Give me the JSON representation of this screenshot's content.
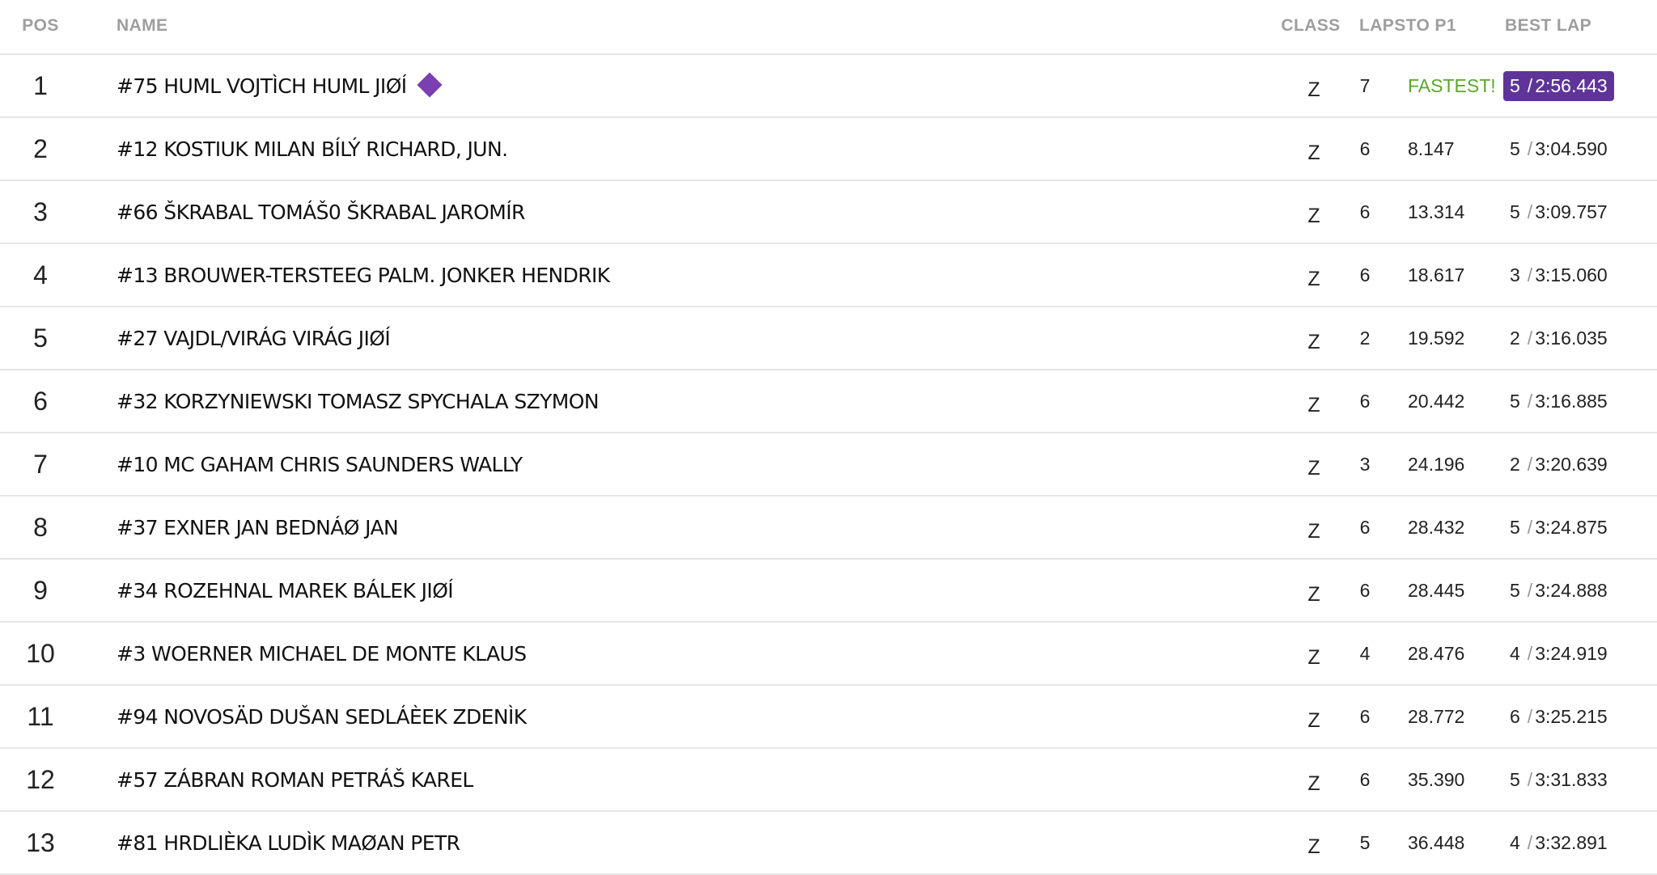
{
  "header": {
    "pos": "POS",
    "name": "NAME",
    "class": "CLASS",
    "laps_to_p1": "LAPSTO P1",
    "best_lap": "BEST LAP"
  },
  "rows": [
    {
      "pos": "1",
      "name": "#75 HUML VOJTÌCH HUML JIØÍ",
      "class": "Z",
      "laps": "7",
      "gap": "FASTEST!",
      "best_lap_no": "5",
      "best_time": "2:56.443",
      "best_icon": "diamond-icon"
    },
    {
      "pos": "2",
      "name": "#12 KOSTIUK MILAN BÍLÝ RICHARD, JUN.",
      "class": "Z",
      "laps": "6",
      "gap": "8.147",
      "best_lap_no": "5",
      "best_time": "3:04.590"
    },
    {
      "pos": "3",
      "name": "#66 ŠKRABAL TOMÁŠ0 ŠKRABAL JAROMÍR",
      "class": "Z",
      "laps": "6",
      "gap": "13.314",
      "best_lap_no": "5",
      "best_time": "3:09.757"
    },
    {
      "pos": "4",
      "name": "#13 BROUWER-TERSTEEG PALM. JONKER HENDRIK",
      "class": "Z",
      "laps": "6",
      "gap": "18.617",
      "best_lap_no": "3",
      "best_time": "3:15.060"
    },
    {
      "pos": "5",
      "name": "#27 VAJDL/VIRÁG VIRÁG JIØÍ",
      "class": "Z",
      "laps": "2",
      "gap": "19.592",
      "best_lap_no": "2",
      "best_time": "3:16.035"
    },
    {
      "pos": "6",
      "name": "#32 KORZYNIEWSKI TOMASZ SPYCHALA SZYMON",
      "class": "Z",
      "laps": "6",
      "gap": "20.442",
      "best_lap_no": "5",
      "best_time": "3:16.885"
    },
    {
      "pos": "7",
      "name": "#10 MC GAHAM CHRIS SAUNDERS WALLY",
      "class": "Z",
      "laps": "3",
      "gap": "24.196",
      "best_lap_no": "2",
      "best_time": "3:20.639"
    },
    {
      "pos": "8",
      "name": "#37 EXNER JAN BEDNÁØ JAN",
      "class": "Z",
      "laps": "6",
      "gap": "28.432",
      "best_lap_no": "5",
      "best_time": "3:24.875"
    },
    {
      "pos": "9",
      "name": "#34 ROZEHNAL MAREK BÁLEK JIØÍ",
      "class": "Z",
      "laps": "6",
      "gap": "28.445",
      "best_lap_no": "5",
      "best_time": "3:24.888"
    },
    {
      "pos": "10",
      "name": "#3 WOERNER MICHAEL DE MONTE KLAUS",
      "class": "Z",
      "laps": "4",
      "gap": "28.476",
      "best_lap_no": "4",
      "best_time": "3:24.919"
    },
    {
      "pos": "11",
      "name": "#94 NOVOSÄD DUŠAN SEDLÁÈEK ZDENÌK",
      "class": "Z",
      "laps": "6",
      "gap": "28.772",
      "best_lap_no": "6",
      "best_time": "3:25.215"
    },
    {
      "pos": "12",
      "name": "#57 ZÁBRAN ROMAN PETRÁŠ KAREL",
      "class": "Z",
      "laps": "6",
      "gap": "35.390",
      "best_lap_no": "5",
      "best_time": "3:31.833"
    },
    {
      "pos": "13",
      "name": "#81 HRDLIÈKA LUDÌK MAØAN PETR",
      "class": "Z",
      "laps": "5",
      "gap": "36.448",
      "best_lap_no": "4",
      "best_time": "3:32.891"
    }
  ],
  "best_sep": "/",
  "colors": {
    "fastest_text": "#5aa82a",
    "best_highlight_bg": "#5e3499",
    "diamond": "#7b3fb2",
    "header_text": "#9e9e9e",
    "divider": "#e6e6e6"
  }
}
